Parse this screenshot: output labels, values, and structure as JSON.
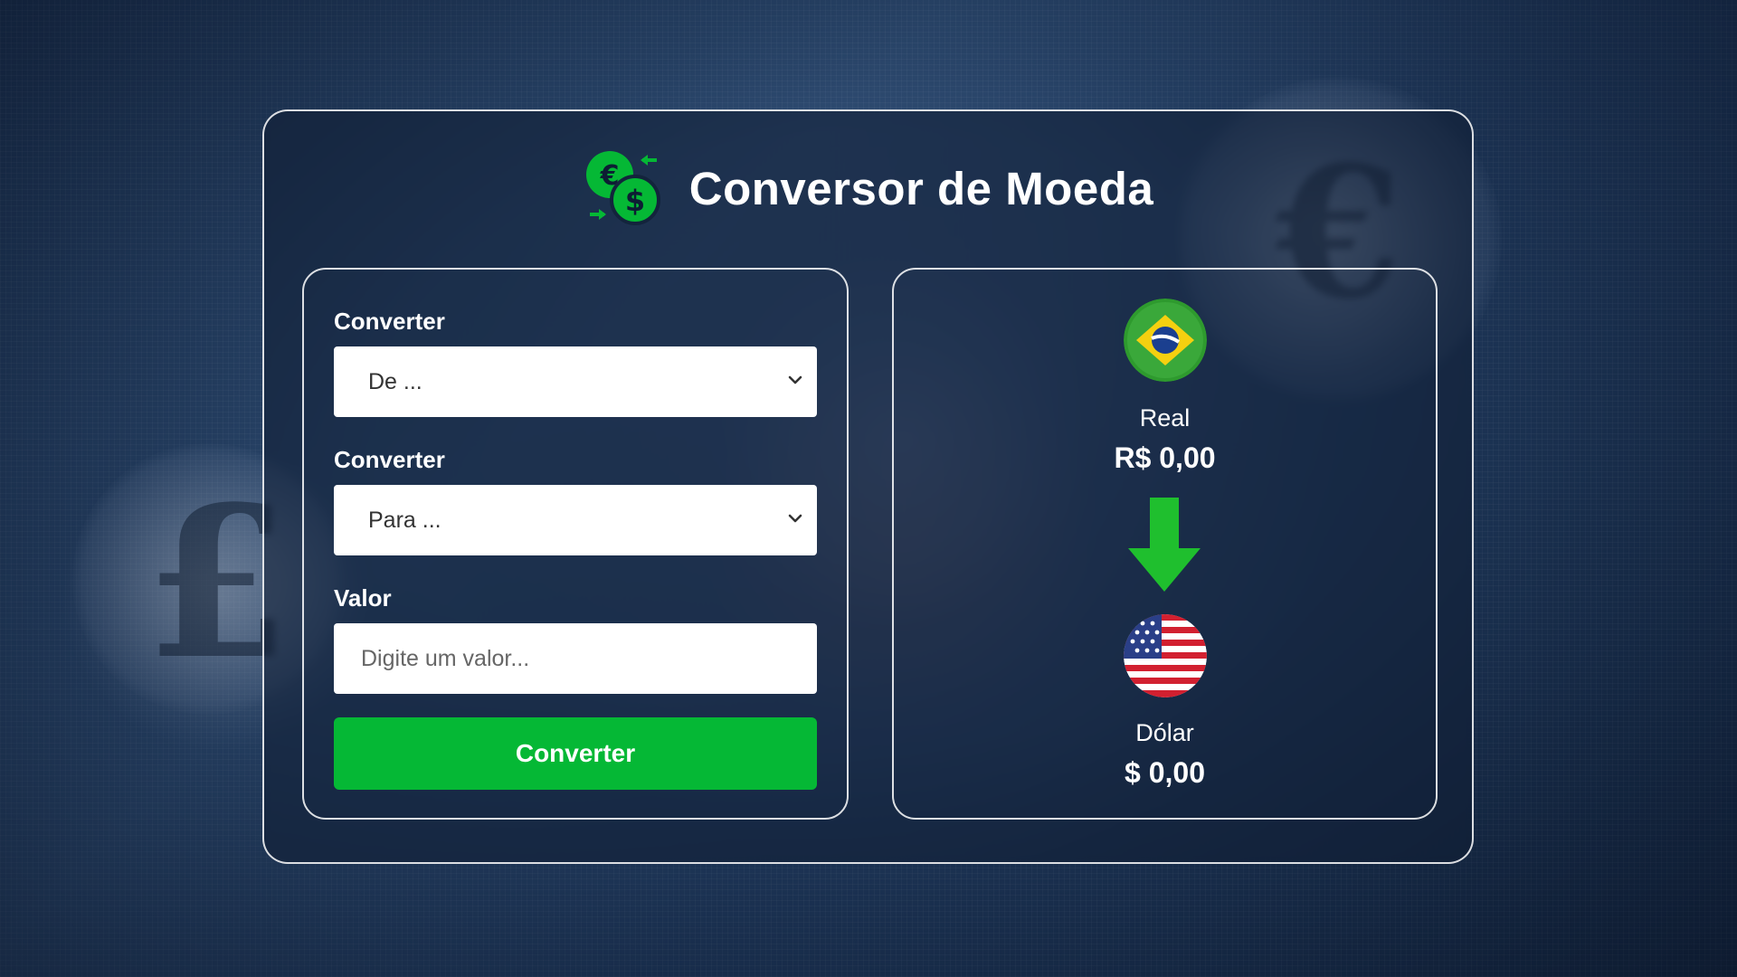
{
  "app": {
    "title": "Conversor de Moeda",
    "logo_icon": "currency-exchange-icon",
    "accent_color": "#05b835"
  },
  "form": {
    "from": {
      "label": "Converter",
      "selected": "De ..."
    },
    "to": {
      "label": "Converter",
      "selected": "Para ..."
    },
    "amount": {
      "label": "Valor",
      "value": "",
      "placeholder": "Digite um valor..."
    },
    "submit_label": "Converter"
  },
  "result": {
    "source": {
      "flag_icon": "brazil-flag-icon",
      "name": "Real",
      "value": "R$ 0,00"
    },
    "arrow_icon": "arrow-down-icon",
    "target": {
      "flag_icon": "usa-flag-icon",
      "name": "Dólar",
      "value": "$ 0,00"
    }
  }
}
